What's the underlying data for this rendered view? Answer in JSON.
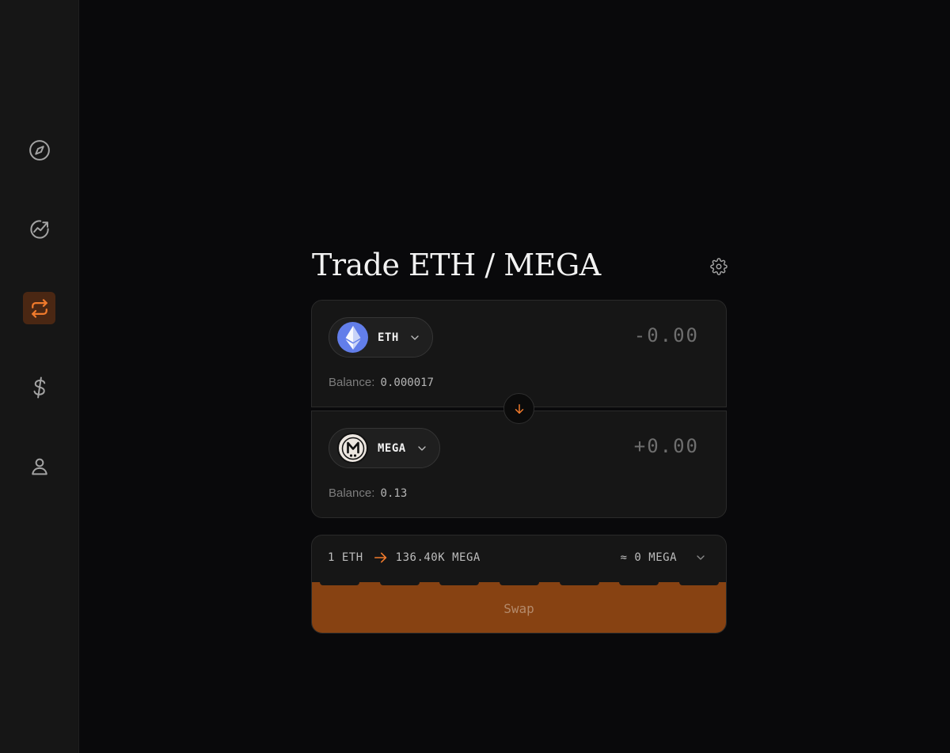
{
  "sidebar": {
    "items": [
      {
        "icon": "compass-icon",
        "active": false
      },
      {
        "icon": "trending-chart-icon",
        "active": false
      },
      {
        "icon": "swap-icon",
        "active": true
      },
      {
        "icon": "dollar-icon",
        "active": false
      },
      {
        "icon": "user-icon",
        "active": false
      }
    ]
  },
  "header": {
    "title": "Trade ETH / MEGA",
    "settings_icon": "gear-icon"
  },
  "from": {
    "symbol": "ETH",
    "amount": "-0.00",
    "balance_label": "Balance:",
    "balance_value": "0.000017"
  },
  "to": {
    "symbol": "MEGA",
    "amount": "+0.00",
    "balance_label": "Balance:",
    "balance_value": "0.13"
  },
  "rate": {
    "from": "1 ETH",
    "to": "136.40K MEGA",
    "estimate": "≈ 0 MEGA"
  },
  "swap": {
    "label": "Swap"
  },
  "colors": {
    "accent": "#f07a2c",
    "swap_button": "#874212",
    "panel": "#161616",
    "background": "#09090b"
  }
}
